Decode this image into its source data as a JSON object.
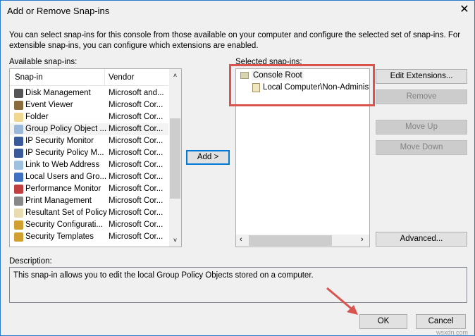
{
  "window": {
    "title": "Add or Remove Snap-ins",
    "close_icon": "close-icon"
  },
  "intro": "You can select snap-ins for this console from those available on your computer and configure the selected set of snap-ins. For extensible snap-ins, you can configure which extensions are enabled.",
  "available": {
    "label": "Available snap-ins:",
    "columns": [
      "Snap-in",
      "Vendor"
    ],
    "items": [
      {
        "name": "Disk Management",
        "vendor": "Microsoft and...",
        "color": "#555"
      },
      {
        "name": "Event Viewer",
        "vendor": "Microsoft Cor...",
        "color": "#8a6d3b"
      },
      {
        "name": "Folder",
        "vendor": "Microsoft Cor...",
        "color": "#f0d890"
      },
      {
        "name": "Group Policy Object ...",
        "vendor": "Microsoft Cor...",
        "color": "#9cb8d8"
      },
      {
        "name": "IP Security Monitor",
        "vendor": "Microsoft Cor...",
        "color": "#3a5a9a"
      },
      {
        "name": "IP Security Policy M...",
        "vendor": "Microsoft Cor...",
        "color": "#3a5a9a"
      },
      {
        "name": "Link to Web Address",
        "vendor": "Microsoft Cor...",
        "color": "#a0c0e0"
      },
      {
        "name": "Local Users and Gro...",
        "vendor": "Microsoft Cor...",
        "color": "#4070c0"
      },
      {
        "name": "Performance Monitor",
        "vendor": "Microsoft Cor...",
        "color": "#c04040"
      },
      {
        "name": "Print Management",
        "vendor": "Microsoft Cor...",
        "color": "#888"
      },
      {
        "name": "Resultant Set of Policy",
        "vendor": "Microsoft Cor...",
        "color": "#e8dcb0"
      },
      {
        "name": "Security Configurati...",
        "vendor": "Microsoft Cor...",
        "color": "#d0a030"
      },
      {
        "name": "Security Templates",
        "vendor": "Microsoft Cor...",
        "color": "#d0a030"
      }
    ],
    "selected_index": 3
  },
  "add_label": "Add >",
  "selected": {
    "label": "Selected snap-ins:",
    "root": "Console Root",
    "child": "Local Computer\\Non-Administra"
  },
  "buttons": {
    "edit_extensions": "Edit Extensions...",
    "remove": "Remove",
    "move_up": "Move Up",
    "move_down": "Move Down",
    "advanced": "Advanced...",
    "ok": "OK",
    "cancel": "Cancel"
  },
  "description": {
    "label": "Description:",
    "text": "This snap-in allows you to edit the local Group Policy Objects stored on a computer."
  },
  "watermark": "wsxdn.com"
}
